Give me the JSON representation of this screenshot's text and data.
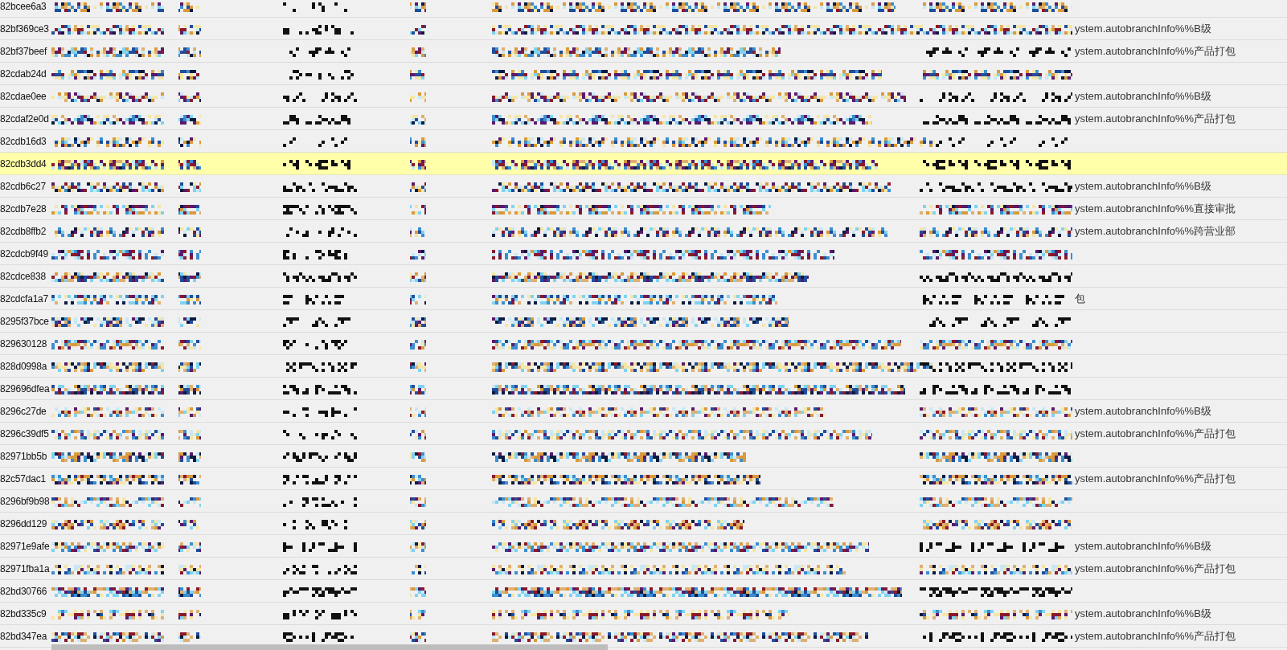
{
  "rows": [
    {
      "id": "82bcee6a3",
      "selected": false
    },
    {
      "id": "82bf369ce3",
      "selected": false,
      "note": "ystem.autobranchInfo%%B级"
    },
    {
      "id": "82bf37beef",
      "selected": false,
      "note": "ystem.autobranchInfo%%产品打包"
    },
    {
      "id": "82cdab24d",
      "selected": false
    },
    {
      "id": "82cdae0ee",
      "selected": false,
      "note": "ystem.autobranchInfo%%B级"
    },
    {
      "id": "82cdaf2e0d",
      "selected": false,
      "note": "ystem.autobranchInfo%%产品打包"
    },
    {
      "id": "82cdb16d3",
      "selected": false
    },
    {
      "id": "82cdb3dd4",
      "selected": true
    },
    {
      "id": "82cdb6c27",
      "selected": false,
      "note": "ystem.autobranchInfo%%B级"
    },
    {
      "id": "82cdb7e28",
      "selected": false,
      "note": "ystem.autobranchInfo%%直接审批"
    },
    {
      "id": "82cdb8ffb2",
      "selected": false,
      "note": "ystem.autobranchInfo%%跨营业部"
    },
    {
      "id": "82cdcb9f49",
      "selected": false
    },
    {
      "id": "82cdce838",
      "selected": false
    },
    {
      "id": "82cdcfa1a7",
      "selected": false,
      "note": "包"
    },
    {
      "id": "8295f37bce",
      "selected": false
    },
    {
      "id": "829630128",
      "selected": false
    },
    {
      "id": "828d0998a",
      "selected": false
    },
    {
      "id": "829696dfea",
      "selected": false
    },
    {
      "id": "8296c27de",
      "selected": false,
      "note": "ystem.autobranchInfo%%B级"
    },
    {
      "id": "8296c39df5",
      "selected": false,
      "note": "ystem.autobranchInfo%%产品打包"
    },
    {
      "id": "82971bb5b",
      "selected": false
    },
    {
      "id": "82c57dac1",
      "selected": false,
      "note": "ystem.autobranchInfo%%产品打包"
    },
    {
      "id": "8296bf9b98",
      "selected": false
    },
    {
      "id": "8296dd129",
      "selected": false
    },
    {
      "id": "82971e9afe",
      "selected": false,
      "note": "ystem.autobranchInfo%%B级"
    },
    {
      "id": "82971fba1a",
      "selected": false,
      "note": "ystem.autobranchInfo%%产品打包"
    },
    {
      "id": "82bd30766",
      "selected": false
    },
    {
      "id": "82bd335c9",
      "selected": false,
      "note": "ystem.autobranchInfo%%B级"
    },
    {
      "id": "82bd347ea",
      "selected": false,
      "note": "ystem.autobranchInfo%%产品打包"
    }
  ]
}
